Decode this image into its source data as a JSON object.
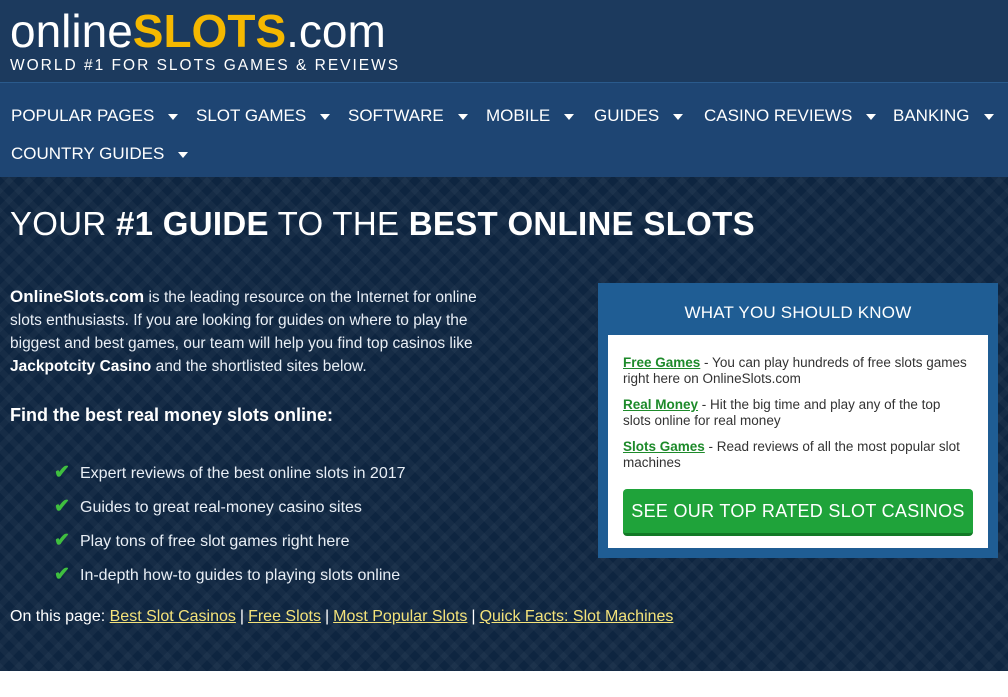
{
  "logo": {
    "online": "online",
    "slots": "SLOTS",
    "dot": ".",
    "com": "com",
    "tagline": "WORLD #1 FOR SLOTS GAMES & REVIEWS"
  },
  "nav": {
    "items": [
      {
        "label": "POPULAR PAGES"
      },
      {
        "label": "SLOT GAMES"
      },
      {
        "label": "SOFTWARE"
      },
      {
        "label": "MOBILE"
      },
      {
        "label": "GUIDES"
      },
      {
        "label": "CASINO REVIEWS"
      },
      {
        "label": "BANKING"
      },
      {
        "label": "COUNTRY GUIDES"
      }
    ]
  },
  "hero": {
    "part1": "YOUR ",
    "part2": "#1 GUIDE",
    "part3": " TO THE ",
    "part4": "BEST ONLINE SLOTS"
  },
  "intro": {
    "brand": "OnlineSlots.com",
    "text1": " is the leading resource on the Internet for online slots enthusiasts. If you are looking for guides on where to play the biggest and best games, our team will help you find top casinos like ",
    "casino": "Jackpotcity Casino",
    "text2": " and the shortlisted sites below."
  },
  "find_heading": "Find the best real money slots online:",
  "checklist": [
    "Expert reviews of the best online slots in 2017",
    "Guides to great real-money casino sites",
    "Play tons of free slot games right here",
    "In-depth how-to guides to playing slots online"
  ],
  "on_page": {
    "label": "On this page: ",
    "links": [
      "Best Slot Casinos",
      "Free Slots",
      "Most Popular Slots",
      "Quick Facts: Slot Machines"
    ],
    "separator": "|"
  },
  "know": {
    "title": "WHAT YOU SHOULD KNOW",
    "items": [
      {
        "link": "Free Games",
        "text": " - You can play hundreds of free slots games right here on OnlineSlots.com"
      },
      {
        "link": "Real Money",
        "text": " - Hit the big time and play any of the top slots online for real money"
      },
      {
        "link": "Slots Games",
        "text": " - Read reviews of all the most popular slot machines"
      }
    ],
    "cta": "SEE OUR TOP RATED SLOT CASINOS"
  },
  "colors": {
    "header_bg": "#1c3a5e",
    "nav_bg": "#1e4573",
    "brand_yellow": "#f5b800",
    "cta_green": "#1fa33a",
    "link_yellow": "#f3e27a"
  },
  "icons": {
    "nav_caret": "caret-down-icon",
    "check": "check-icon"
  }
}
